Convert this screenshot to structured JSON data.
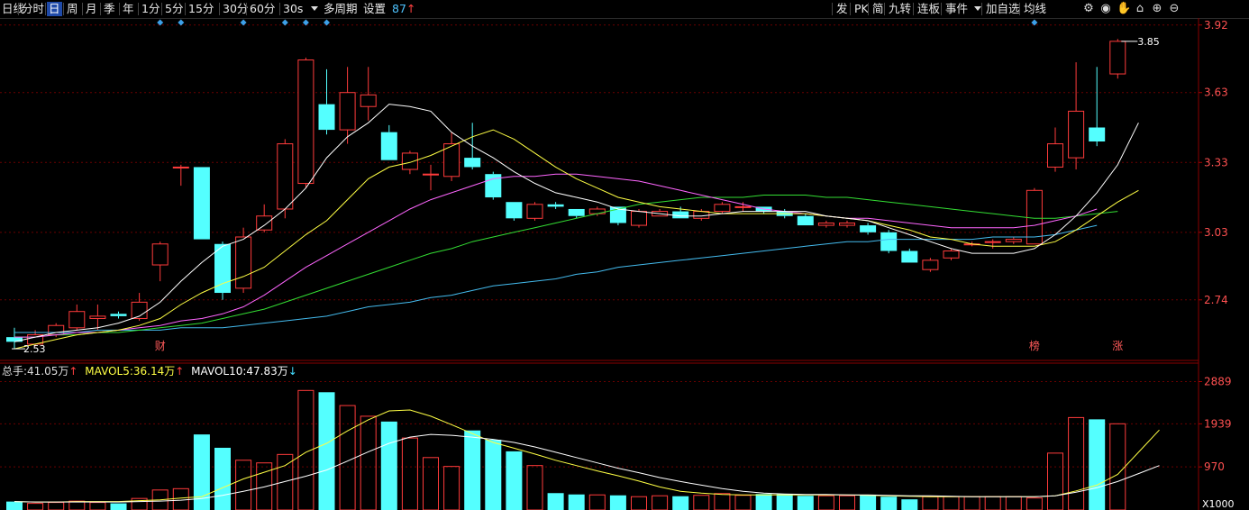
{
  "toolbar": {
    "left": [
      {
        "label": "日线",
        "name": "period-day-line"
      },
      {
        "label": "分时",
        "name": "period-intraday"
      },
      {
        "label": "日",
        "name": "period-day",
        "active": true
      },
      {
        "label": "周",
        "name": "period-week"
      },
      {
        "label": "月",
        "name": "period-month"
      },
      {
        "label": "季",
        "name": "period-quarter"
      },
      {
        "label": "年",
        "name": "period-year"
      },
      {
        "label": "1分",
        "name": "period-1min"
      },
      {
        "label": "5分",
        "name": "period-5min"
      },
      {
        "label": "15分",
        "name": "period-15min"
      },
      {
        "label": "30分",
        "name": "period-30min"
      },
      {
        "label": "60分",
        "name": "period-60min"
      },
      {
        "label": "30s",
        "name": "period-30s"
      }
    ],
    "multi_period": "多周期",
    "settings": "设置",
    "settings_value": "87",
    "settings_arrow": "↑",
    "right": [
      {
        "label": "发",
        "name": "btn-fa"
      },
      {
        "label": "PK",
        "name": "btn-pk"
      },
      {
        "label": "简",
        "name": "btn-jian"
      },
      {
        "label": "九转",
        "name": "btn-jiuzhuan"
      },
      {
        "label": "连板",
        "name": "btn-lianban"
      },
      {
        "label": "事件",
        "name": "btn-event"
      },
      {
        "label": "加自选",
        "name": "btn-add-watchlist"
      },
      {
        "label": "均线",
        "name": "btn-ma"
      }
    ],
    "icons": [
      "gear-icon",
      "eye-icon",
      "hand-icon",
      "home-icon",
      "zoom-in-icon",
      "zoom-out-icon"
    ]
  },
  "price_axis": {
    "labels": [
      "3.92",
      "3.63",
      "3.33",
      "3.03",
      "2.74"
    ],
    "min": 2.48,
    "max": 3.95
  },
  "price_markers": {
    "high": "3.85",
    "low": "2.53"
  },
  "event_markers": [
    {
      "label": "财",
      "index": 7
    },
    {
      "label": "榜",
      "index": 49
    },
    {
      "label": "涨",
      "index": 53
    }
  ],
  "top_diamonds": [
    7,
    8,
    11,
    13,
    14,
    15,
    49
  ],
  "volume": {
    "legend": {
      "total_label": "总手:",
      "total_value": "41.05万",
      "total_arrow": "↑",
      "ma5_label": "MAVOL5:",
      "ma5_value": "36.14万",
      "ma5_arrow": "↑",
      "ma10_label": "MAVOL10:",
      "ma10_value": "47.83万",
      "ma10_arrow": "↓"
    },
    "axis_labels": [
      "2889",
      "1939",
      "970"
    ],
    "unit": "X1000",
    "max": 2960
  },
  "colors": {
    "up": "#ff3b3b",
    "down": "#54ffff",
    "ma5": "#ffffff",
    "ma10": "#ffff44",
    "ma20": "#ff66ff",
    "ma60": "#33dd33",
    "ma120": "#44bbee",
    "grid": "#6a0000"
  },
  "chart_data": {
    "type": "candlestick",
    "candles": [
      [
        2.58,
        2.56,
        2.62,
        2.53
      ],
      [
        2.55,
        2.59,
        2.61,
        2.54
      ],
      [
        2.59,
        2.63,
        2.64,
        2.58
      ],
      [
        2.62,
        2.69,
        2.72,
        2.61
      ],
      [
        2.66,
        2.67,
        2.72,
        2.61
      ],
      [
        2.68,
        2.67,
        2.69,
        2.66
      ],
      [
        2.66,
        2.73,
        2.77,
        2.65
      ],
      [
        2.89,
        2.98,
        2.99,
        2.82
      ],
      [
        3.31,
        3.31,
        3.32,
        3.23
      ],
      [
        3.31,
        3.0,
        3.31,
        3.0
      ],
      [
        2.98,
        2.77,
        2.99,
        2.74
      ],
      [
        2.79,
        3.01,
        3.05,
        2.77
      ],
      [
        3.04,
        3.1,
        3.15,
        3.03
      ],
      [
        3.13,
        3.41,
        3.43,
        3.09
      ],
      [
        3.24,
        3.77,
        3.78,
        3.22
      ],
      [
        3.58,
        3.47,
        3.73,
        3.45
      ],
      [
        3.47,
        3.63,
        3.74,
        3.41
      ],
      [
        3.57,
        3.62,
        3.74,
        3.51
      ],
      [
        3.46,
        3.34,
        3.49,
        3.34
      ],
      [
        3.3,
        3.37,
        3.38,
        3.28
      ],
      [
        3.28,
        3.28,
        3.32,
        3.21
      ],
      [
        3.27,
        3.41,
        3.46,
        3.25
      ],
      [
        3.35,
        3.31,
        3.5,
        3.3
      ],
      [
        3.28,
        3.18,
        3.29,
        3.17
      ],
      [
        3.16,
        3.09,
        3.16,
        3.08
      ],
      [
        3.09,
        3.15,
        3.16,
        3.08
      ],
      [
        3.15,
        3.14,
        3.16,
        3.13
      ],
      [
        3.13,
        3.1,
        3.13,
        3.09
      ],
      [
        3.11,
        3.13,
        3.14,
        3.1
      ],
      [
        3.14,
        3.07,
        3.14,
        3.06
      ],
      [
        3.06,
        3.12,
        3.13,
        3.05
      ],
      [
        3.1,
        3.12,
        3.13,
        3.1
      ],
      [
        3.12,
        3.09,
        3.14,
        3.09
      ],
      [
        3.09,
        3.12,
        3.13,
        3.08
      ],
      [
        3.12,
        3.15,
        3.16,
        3.11
      ],
      [
        3.14,
        3.14,
        3.16,
        3.12
      ],
      [
        3.14,
        3.12,
        3.14,
        3.11
      ],
      [
        3.12,
        3.1,
        3.13,
        3.09
      ],
      [
        3.1,
        3.06,
        3.11,
        3.06
      ],
      [
        3.06,
        3.07,
        3.08,
        3.05
      ],
      [
        3.06,
        3.07,
        3.08,
        3.05
      ],
      [
        3.06,
        3.03,
        3.07,
        3.02
      ],
      [
        3.03,
        2.95,
        3.04,
        2.94
      ],
      [
        2.95,
        2.9,
        2.96,
        2.9
      ],
      [
        2.87,
        2.91,
        2.92,
        2.86
      ],
      [
        2.92,
        2.95,
        2.96,
        2.91
      ],
      [
        2.98,
        2.98,
        2.99,
        2.97
      ],
      [
        2.99,
        2.99,
        3.0,
        2.96
      ],
      [
        2.99,
        3.0,
        3.01,
        2.98
      ],
      [
        2.98,
        3.21,
        3.22,
        2.98
      ],
      [
        3.31,
        3.41,
        3.48,
        3.29
      ],
      [
        3.35,
        3.55,
        3.76,
        3.3
      ],
      [
        3.48,
        3.42,
        3.74,
        3.4
      ],
      [
        3.71,
        3.85,
        3.86,
        3.69
      ]
    ],
    "ma5": [
      2.56,
      2.58,
      2.6,
      2.61,
      2.62,
      2.64,
      2.67,
      2.73,
      2.82,
      2.9,
      2.97,
      3.0,
      3.06,
      3.13,
      3.22,
      3.35,
      3.44,
      3.5,
      3.58,
      3.57,
      3.55,
      3.46,
      3.4,
      3.35,
      3.29,
      3.24,
      3.2,
      3.18,
      3.16,
      3.13,
      3.12,
      3.11,
      3.1,
      3.1,
      3.11,
      3.12,
      3.12,
      3.12,
      3.12,
      3.1,
      3.09,
      3.08,
      3.05,
      3.02,
      2.99,
      2.96,
      2.94,
      2.94,
      2.94,
      2.96,
      3.02,
      3.1,
      3.2,
      3.32,
      3.5
    ],
    "ma10": [
      2.53,
      2.55,
      2.57,
      2.59,
      2.6,
      2.61,
      2.63,
      2.66,
      2.72,
      2.77,
      2.81,
      2.84,
      2.88,
      2.95,
      3.02,
      3.08,
      3.17,
      3.26,
      3.31,
      3.33,
      3.36,
      3.4,
      3.44,
      3.47,
      3.43,
      3.37,
      3.31,
      3.26,
      3.22,
      3.18,
      3.16,
      3.14,
      3.13,
      3.12,
      3.11,
      3.11,
      3.11,
      3.11,
      3.11,
      3.1,
      3.09,
      3.08,
      3.06,
      3.04,
      3.01,
      3.0,
      2.98,
      2.97,
      2.97,
      2.97,
      2.99,
      3.04,
      3.1,
      3.16,
      3.21
    ],
    "ma20": [
      2.58,
      2.58,
      2.59,
      2.6,
      2.6,
      2.61,
      2.62,
      2.63,
      2.65,
      2.66,
      2.68,
      2.71,
      2.76,
      2.82,
      2.88,
      2.93,
      2.98,
      3.03,
      3.08,
      3.13,
      3.17,
      3.2,
      3.23,
      3.26,
      3.27,
      3.27,
      3.28,
      3.28,
      3.27,
      3.26,
      3.25,
      3.23,
      3.21,
      3.19,
      3.17,
      3.15,
      3.13,
      3.12,
      3.11,
      3.1,
      3.09,
      3.09,
      3.08,
      3.07,
      3.06,
      3.05,
      3.05,
      3.05,
      3.05,
      3.06,
      3.08,
      3.1,
      3.13
    ],
    "ma60": [
      2.58,
      2.58,
      2.59,
      2.59,
      2.6,
      2.6,
      2.61,
      2.62,
      2.63,
      2.64,
      2.66,
      2.68,
      2.7,
      2.73,
      2.76,
      2.79,
      2.82,
      2.85,
      2.88,
      2.91,
      2.94,
      2.96,
      2.99,
      3.01,
      3.03,
      3.05,
      3.07,
      3.09,
      3.11,
      3.13,
      3.15,
      3.16,
      3.17,
      3.18,
      3.18,
      3.18,
      3.19,
      3.19,
      3.19,
      3.18,
      3.18,
      3.17,
      3.16,
      3.15,
      3.14,
      3.13,
      3.12,
      3.11,
      3.1,
      3.09,
      3.09,
      3.1,
      3.11,
      3.12
    ],
    "ma120": [
      2.6,
      2.6,
      2.6,
      2.6,
      2.61,
      2.61,
      2.61,
      2.61,
      2.62,
      2.62,
      2.62,
      2.63,
      2.64,
      2.65,
      2.66,
      2.67,
      2.69,
      2.71,
      2.72,
      2.73,
      2.75,
      2.76,
      2.78,
      2.8,
      2.81,
      2.82,
      2.83,
      2.85,
      2.86,
      2.88,
      2.89,
      2.9,
      2.91,
      2.92,
      2.93,
      2.94,
      2.95,
      2.96,
      2.97,
      2.98,
      2.99,
      2.99,
      3.0,
      3.0,
      3.0,
      3.0,
      3.0,
      3.01,
      3.01,
      3.01,
      3.02,
      3.04,
      3.06
    ],
    "volumes": [
      190,
      150,
      170,
      200,
      170,
      150,
      260,
      450,
      480,
      1700,
      1400,
      1120,
      1060,
      1250,
      2690,
      2650,
      2350,
      2110,
      1990,
      1620,
      1180,
      980,
      1790,
      1580,
      1320,
      1000,
      380,
      350,
      340,
      330,
      300,
      320,
      310,
      330,
      370,
      330,
      360,
      360,
      320,
      320,
      320,
      330,
      300,
      240,
      300,
      300,
      300,
      300,
      300,
      270,
      1280,
      2080,
      2040,
      1940,
      1960
    ],
    "vol_ma5": [
      190,
      180,
      180,
      190,
      190,
      190,
      210,
      230,
      270,
      300,
      500,
      700,
      850,
      1000,
      1300,
      1500,
      1780,
      2030,
      2230,
      2250,
      2110,
      1920,
      1720,
      1520,
      1390,
      1260,
      1120,
      1000,
      880,
      770,
      650,
      520,
      420,
      380,
      350,
      340,
      340,
      340,
      340,
      340,
      340,
      330,
      320,
      310,
      300,
      300,
      300,
      300,
      300,
      300,
      320,
      430,
      560,
      800,
      1300,
      1800
    ],
    "vol_ma10": [
      190,
      180,
      180,
      180,
      180,
      180,
      190,
      200,
      220,
      260,
      330,
      420,
      520,
      640,
      760,
      900,
      1100,
      1310,
      1500,
      1640,
      1700,
      1680,
      1640,
      1590,
      1520,
      1420,
      1300,
      1180,
      1060,
      940,
      840,
      730,
      640,
      560,
      480,
      420,
      380,
      360,
      350,
      350,
      340,
      340,
      330,
      320,
      320,
      310,
      300,
      300,
      300,
      300,
      320,
      400,
      500,
      640,
      820,
      1000
    ]
  }
}
